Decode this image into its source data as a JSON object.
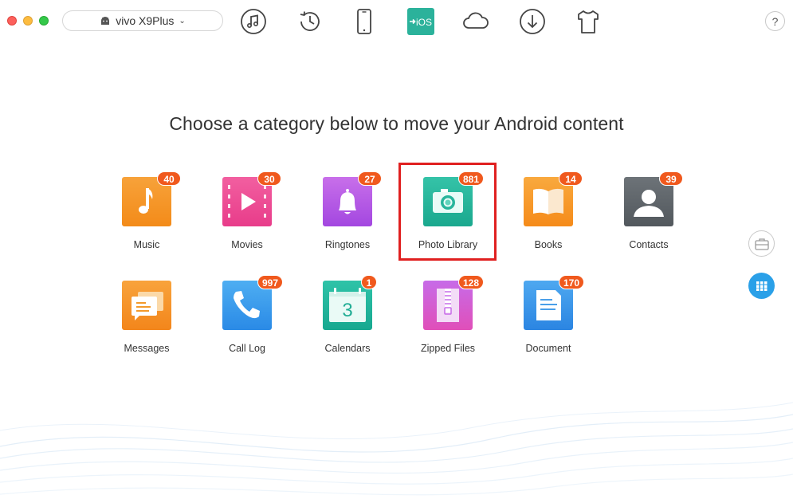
{
  "device": {
    "name": "vivo X9Plus"
  },
  "toolbar": {
    "icons": [
      "music-icon",
      "history-icon",
      "phone-icon",
      "to-ios-icon",
      "cloud-icon",
      "download-icon",
      "shirt-icon"
    ],
    "ios_label": "iOS",
    "help": "?"
  },
  "heading": "Choose a category below to move your Android content",
  "categories": [
    {
      "label": "Music",
      "count": "40",
      "icon": "music-note-icon",
      "colors": [
        "#f7a23a",
        "#f38b19"
      ]
    },
    {
      "label": "Movies",
      "count": "30",
      "icon": "film-icon",
      "colors": [
        "#f25fa0",
        "#e83c8a"
      ]
    },
    {
      "label": "Ringtones",
      "count": "27",
      "icon": "bell-icon",
      "colors": [
        "#c86fea",
        "#a347e0"
      ]
    },
    {
      "label": "Photo Library",
      "count": "881",
      "icon": "camera-icon",
      "colors": [
        "#35c3a8",
        "#1aa88e"
      ]
    },
    {
      "label": "Books",
      "count": "14",
      "icon": "book-icon",
      "colors": [
        "#f9a93e",
        "#f58b1a"
      ]
    },
    {
      "label": "Contacts",
      "count": "39",
      "icon": "contact-icon",
      "colors": [
        "#6d7378",
        "#52585d"
      ]
    },
    {
      "label": "Messages",
      "count": "",
      "icon": "message-icon",
      "colors": [
        "#f8a33c",
        "#f3861b"
      ]
    },
    {
      "label": "Call Log",
      "count": "997",
      "icon": "phone-call-icon",
      "colors": [
        "#4eaef2",
        "#2a8ae6"
      ]
    },
    {
      "label": "Calendars",
      "count": "1",
      "icon": "calendar-icon",
      "colors": [
        "#2fc3a8",
        "#17a890"
      ]
    },
    {
      "label": "Zipped Files",
      "count": "128",
      "icon": "zip-icon",
      "colors": [
        "#c76be8",
        "#e04fb9"
      ]
    },
    {
      "label": "Document",
      "count": "170",
      "icon": "document-icon",
      "colors": [
        "#4ea8f0",
        "#2b85e2"
      ]
    }
  ],
  "calendar_day": "3",
  "selected": "Photo Library",
  "accent": "#2aa0e8",
  "badge_color": "#f0591d"
}
